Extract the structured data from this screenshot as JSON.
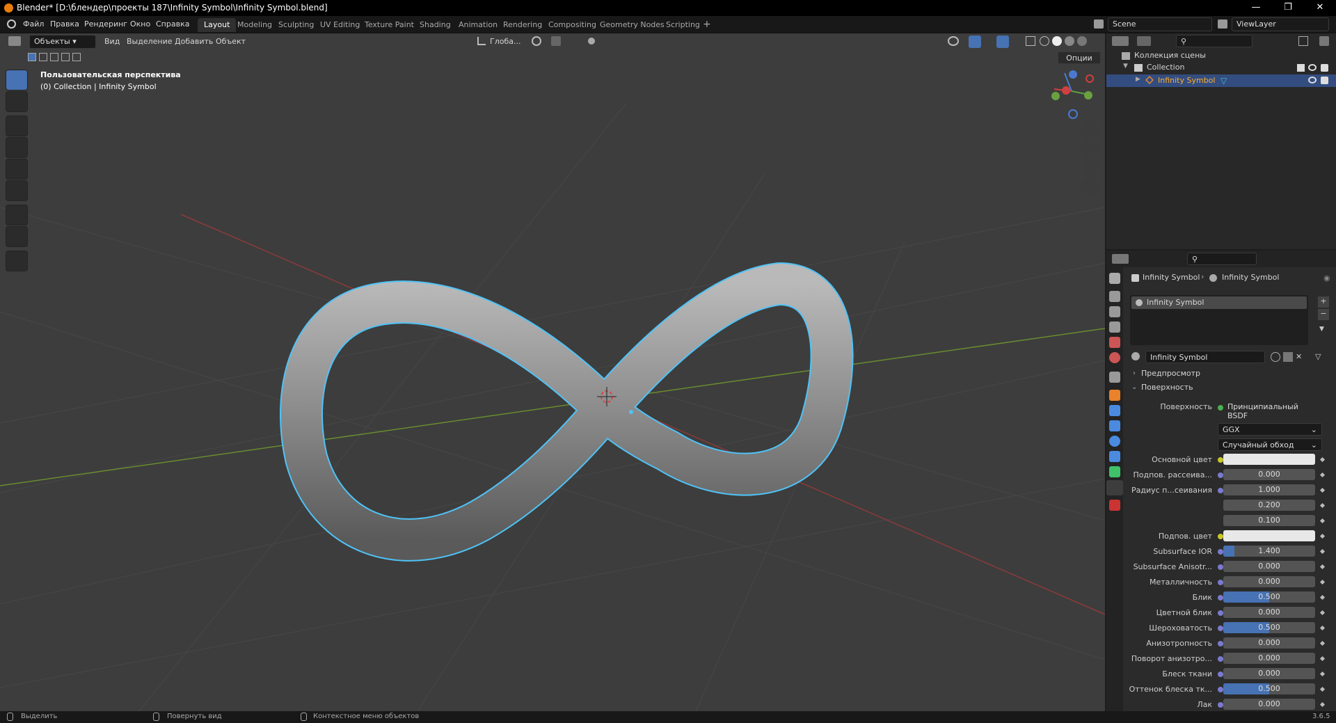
{
  "window": {
    "title": "Blender* [D:\\блендер\\проекты 187\\Infinity Symbol\\Infinity Symbol.blend]"
  },
  "menu": [
    "Файл",
    "Правка",
    "Рендеринг",
    "Окно",
    "Справка"
  ],
  "workspaces": [
    "Layout",
    "Modeling",
    "Sculpting",
    "UV Editing",
    "Texture Paint",
    "Shading",
    "Animation",
    "Rendering",
    "Compositing",
    "Geometry Nodes",
    "Scripting"
  ],
  "scene": {
    "name": "Scene",
    "view_layer": "ViewLayer"
  },
  "viewport": {
    "mode": "Объекты",
    "menus": [
      "Вид",
      "Выделение",
      "Добавить",
      "Объект"
    ],
    "transform_orientation": "Глоба...",
    "options": "Опции",
    "overlay_title": "Пользовательская перспектива",
    "overlay_sub": "(0) Collection | Infinity Symbol"
  },
  "outliner": {
    "root": "Коллекция сцены",
    "collection": "Collection",
    "object": "Infinity Symbol"
  },
  "properties": {
    "breadcrumb_object": "Infinity Symbol",
    "breadcrumb_material": "Infinity Symbol",
    "slot": "Infinity Symbol",
    "material_name": "Infinity Symbol",
    "panel_preview": "Предпросмотр",
    "panel_surface": "Поверхность",
    "surface_label": "Поверхность",
    "surface_value": "Принципиальный BSDF",
    "distribution": "GGX",
    "subsurface_method": "Случайный обход",
    "rows": [
      {
        "label": "Основной цвет",
        "type": "color",
        "value": ""
      },
      {
        "label": "Подпов. рассеива...",
        "type": "slider",
        "value": "0.000",
        "fill": 0
      },
      {
        "label": "Радиус п...сеивания",
        "type": "slider",
        "value": "1.000",
        "fill": 0
      },
      {
        "label": "",
        "type": "slider",
        "value": "0.200",
        "fill": 0
      },
      {
        "label": "",
        "type": "slider",
        "value": "0.100",
        "fill": 0
      },
      {
        "label": "Подпов. цвет",
        "type": "color",
        "value": ""
      },
      {
        "label": "Subsurface IOR",
        "type": "slider",
        "value": "1.400",
        "fill": 0.12
      },
      {
        "label": "Subsurface Anisotr...",
        "type": "slider",
        "value": "0.000",
        "fill": 0
      },
      {
        "label": "Металличность",
        "type": "slider",
        "value": "0.000",
        "fill": 0
      },
      {
        "label": "Блик",
        "type": "slider",
        "value": "0.500",
        "fill": 0.5
      },
      {
        "label": "Цветной блик",
        "type": "slider",
        "value": "0.000",
        "fill": 0
      },
      {
        "label": "Шероховатость",
        "type": "slider",
        "value": "0.500",
        "fill": 0.5
      },
      {
        "label": "Анизотропность",
        "type": "slider",
        "value": "0.000",
        "fill": 0
      },
      {
        "label": "Поворот анизотро...",
        "type": "slider",
        "value": "0.000",
        "fill": 0
      },
      {
        "label": "Блеск ткани",
        "type": "slider",
        "value": "0.000",
        "fill": 0
      },
      {
        "label": "Оттенок блеска тк...",
        "type": "slider",
        "value": "0.500",
        "fill": 0.5
      },
      {
        "label": "Лак",
        "type": "slider",
        "value": "0.000",
        "fill": 0
      }
    ]
  },
  "status": {
    "select": "Выделить",
    "rotate": "Повернуть вид",
    "context": "Контекстное меню объектов",
    "version": "3.6.5"
  }
}
